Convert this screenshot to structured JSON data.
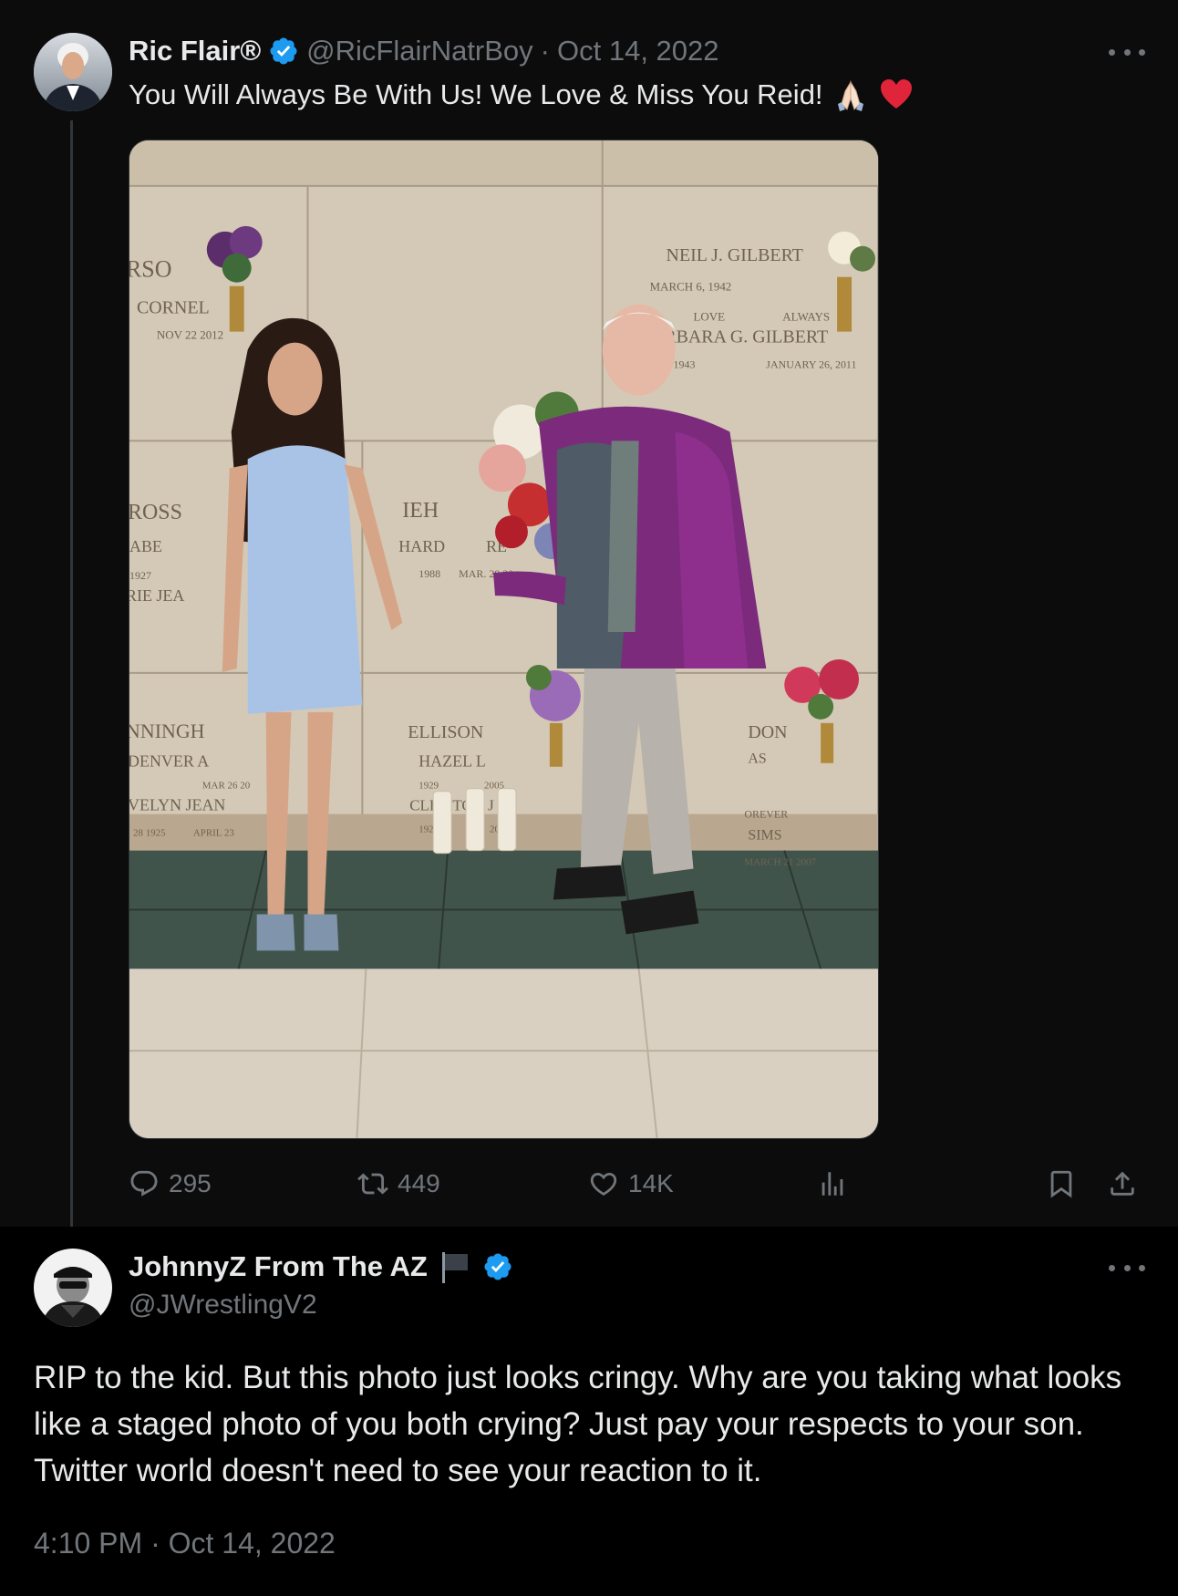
{
  "parent_tweet": {
    "display_name": "Ric Flair®",
    "handle": "@RicFlairNatrBoy",
    "separator": "·",
    "date": "Oct 14, 2022",
    "text": "You Will Always Be With Us! We Love & Miss You Reid!",
    "emojis": [
      "folded-hands",
      "red-heart"
    ],
    "photo": {
      "plaque_lines": [
        "NEIL J. GILBERT",
        "MARCH 6, 1942",
        "LOVE",
        "ALWAYS",
        "BARBARA G. GILBERT",
        "1943",
        "JANUARY 26, 2011",
        "RSO",
        "CORNEL",
        "NOV 22 2012",
        "ROSS",
        "ABE",
        "1927",
        "RIE JEA",
        "IEH",
        "HARD",
        "RE",
        "1988",
        "MAR. 29 20",
        "NNINGH",
        "DENVER A",
        "MAR 26 20",
        "VELYN JEAN",
        "28 1925",
        "APRIL 23",
        "ELLISON",
        "HAZEL L",
        "1929",
        "2005",
        "CLEMTON J",
        "1926",
        "2007",
        "DON",
        "AS",
        "OREVER",
        "SIMS",
        "MARCH 21 2007"
      ]
    },
    "stats": {
      "replies": "295",
      "reposts": "449",
      "likes": "14K"
    }
  },
  "reply_tweet": {
    "display_name": "JohnnyZ From The AZ",
    "handle": "@JWrestlingV2",
    "text": "RIP to the kid. But this photo just looks cringy.  Why are you taking what looks like a staged photo of you both crying? Just pay your respects to your son. Twitter world doesn't need to see your reaction to it.",
    "time": "4:10 PM",
    "separator": "·",
    "date": "Oct 14, 2022"
  },
  "colors": {
    "background": "#000000",
    "parent_card_bg": "#0c0c0d",
    "text_primary": "#e7e9ea",
    "text_secondary": "#71767b",
    "verified_blue": "#1d9bf0"
  }
}
